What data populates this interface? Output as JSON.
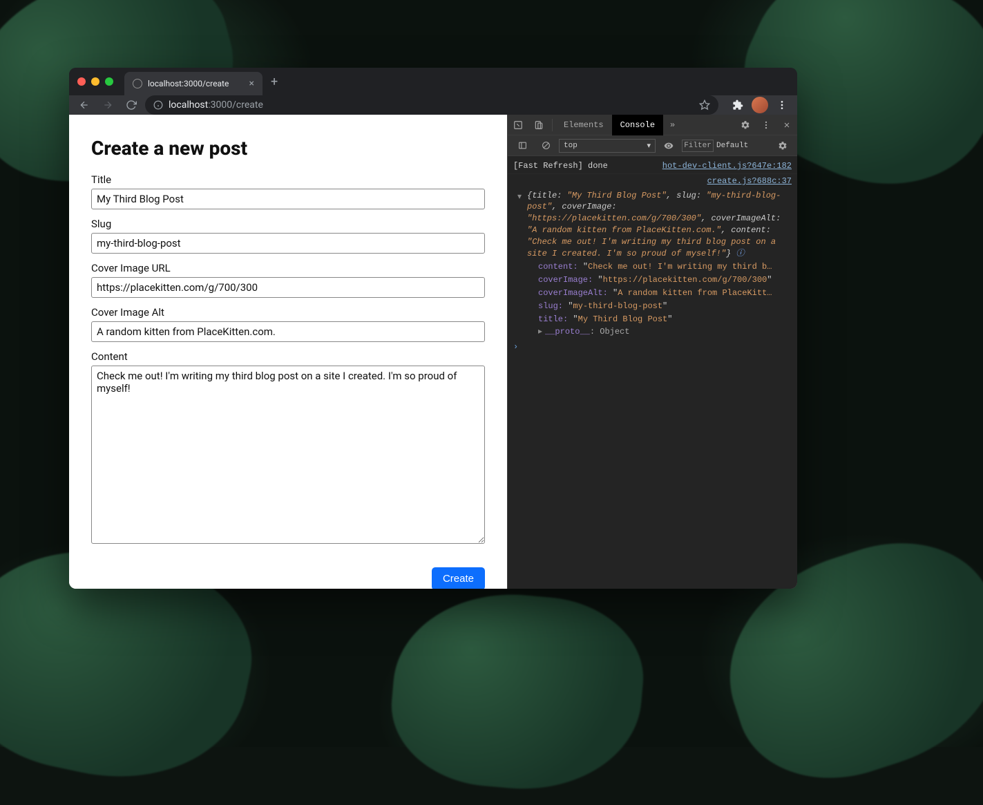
{
  "browser": {
    "tab_title": "localhost:3000/create",
    "url_host": "localhost",
    "url_path": ":3000/create"
  },
  "page": {
    "heading": "Create a new post",
    "fields": {
      "title_label": "Title",
      "title_value": "My Third Blog Post",
      "slug_label": "Slug",
      "slug_value": "my-third-blog-post",
      "cover_url_label": "Cover Image URL",
      "cover_url_value": "https://placekitten.com/g/700/300",
      "cover_alt_label": "Cover Image Alt",
      "cover_alt_value": "A random kitten from PlaceKitten.com.",
      "content_label": "Content",
      "content_value": "Check me out! I'm writing my third blog post on a site I created. I'm so proud of myself!"
    },
    "submit_label": "Create"
  },
  "devtools": {
    "tabs": {
      "elements": "Elements",
      "console": "Console"
    },
    "toolbar": {
      "context": "top",
      "filter_placeholder": "Filter",
      "levels": "Default"
    },
    "log_fast_refresh": "[Fast Refresh] done",
    "src_hot": "hot-dev-client.js?647e:182",
    "src_create": "create.js?688c:37",
    "object_summary": {
      "title": "My Third Blog Post",
      "slug": "my-third-blog-post",
      "coverImage": "https://placekitten.com/g/700/300",
      "coverImageAlt": "A random kitten from PlaceKitten.com.",
      "content": "Check me out! I'm writing my third blog post on a site I created. I'm so proud of myself!"
    },
    "expanded": {
      "content_key": "content:",
      "content_val": "Check me out! I'm writing my third b…",
      "coverImage_key": "coverImage:",
      "coverImage_val": "https://placekitten.com/g/700/300",
      "coverImageAlt_key": "coverImageAlt:",
      "coverImageAlt_val": "A random kitten from PlaceKitt…",
      "slug_key": "slug:",
      "slug_val": "my-third-blog-post",
      "title_key": "title:",
      "title_val": "My Third Blog Post"
    },
    "proto_label": "__proto__",
    "proto_value": "Object"
  }
}
